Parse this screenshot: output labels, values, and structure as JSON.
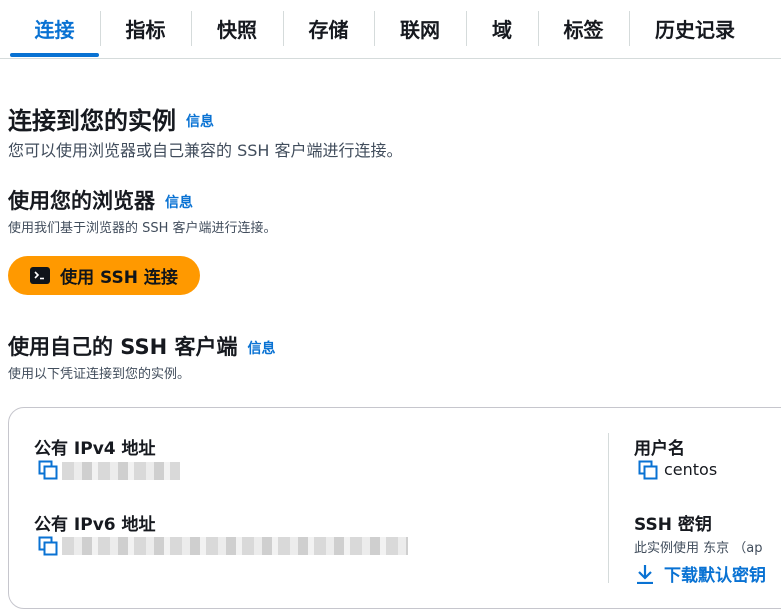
{
  "tabs": [
    {
      "label": "连接",
      "active": true
    },
    {
      "label": "指标"
    },
    {
      "label": "快照"
    },
    {
      "label": "存储"
    },
    {
      "label": "联网"
    },
    {
      "label": "域"
    },
    {
      "label": "标签"
    },
    {
      "label": "历史记录"
    }
  ],
  "connect": {
    "title": "连接到您的实例",
    "info": "信息",
    "description": "您可以使用浏览器或自己兼容的 SSH 客户端进行连接。"
  },
  "browser": {
    "title": "使用您的浏览器",
    "info": "信息",
    "description": "使用我们基于浏览器的 SSH 客户端进行连接。",
    "button_label": "使用 SSH 连接",
    "button_color": "#ff9900"
  },
  "own_client": {
    "title": "使用自己的 SSH 客户端",
    "info": "信息",
    "description": "使用以下凭证连接到您的实例。",
    "public_ipv4_label": "公有 IPv4 地址",
    "public_ipv6_label": "公有 IPv6 地址",
    "username_label": "用户名",
    "username_value": "centos",
    "ssh_key_label": "SSH 密钥",
    "ssh_key_note": "此实例使用 东京 （ap",
    "download_label": "下载默认密钥"
  },
  "icons": {
    "terminal": "terminal-icon",
    "copy": "copy-icon",
    "download": "download-icon"
  },
  "colors": {
    "accent": "#0972d3",
    "text": "#16191f",
    "muted": "#414d5c"
  }
}
